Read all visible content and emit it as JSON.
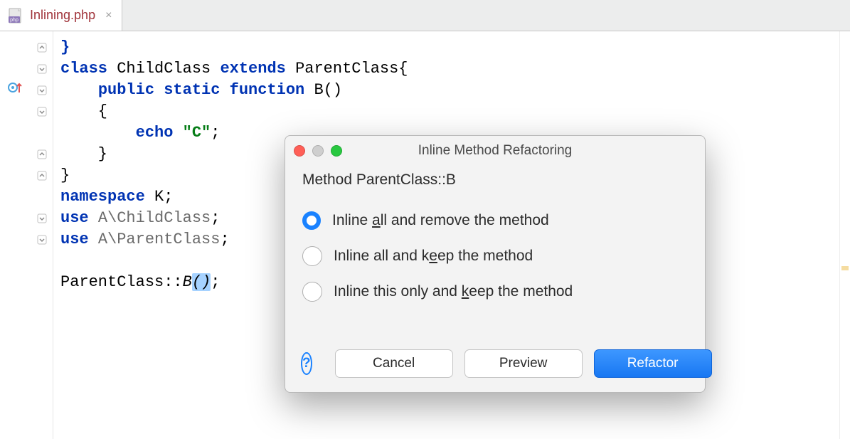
{
  "tab": {
    "filename": "Inlining.php",
    "close_glyph": "×"
  },
  "code": {
    "highlighted_line_index": 10,
    "lines": [
      {
        "tokens": [
          {
            "t": "}",
            "c": "kw"
          }
        ]
      },
      {
        "tokens": [
          {
            "t": "class ",
            "c": "kw"
          },
          {
            "t": "ChildClass ",
            "c": "cls"
          },
          {
            "t": "extends ",
            "c": "kw"
          },
          {
            "t": "ParentClass{",
            "c": "cls"
          }
        ]
      },
      {
        "tokens": [
          {
            "t": "    ",
            "c": ""
          },
          {
            "t": "public static function ",
            "c": "kw"
          },
          {
            "t": "B()",
            "c": "cls"
          }
        ]
      },
      {
        "tokens": [
          {
            "t": "    {",
            "c": "cls"
          }
        ]
      },
      {
        "tokens": [
          {
            "t": "        ",
            "c": ""
          },
          {
            "t": "echo ",
            "c": "kw"
          },
          {
            "t": "\"C\"",
            "c": "str"
          },
          {
            "t": ";",
            "c": "cls"
          }
        ]
      },
      {
        "tokens": [
          {
            "t": "    }",
            "c": "cls"
          }
        ]
      },
      {
        "tokens": [
          {
            "t": "}",
            "c": "cls"
          }
        ]
      },
      {
        "tokens": [
          {
            "t": "namespace ",
            "c": "kw"
          },
          {
            "t": "K;",
            "c": "cls"
          }
        ]
      },
      {
        "tokens": [
          {
            "t": "use ",
            "c": "kw"
          },
          {
            "t": "A\\ChildClass",
            "c": "ns"
          },
          {
            "t": ";",
            "c": "cls"
          }
        ]
      },
      {
        "tokens": [
          {
            "t": "use ",
            "c": "kw"
          },
          {
            "t": "A\\ParentClass",
            "c": "ns"
          },
          {
            "t": ";",
            "c": "cls"
          }
        ]
      },
      {
        "tokens": []
      },
      {
        "tokens": [
          {
            "t": "ParentClass::",
            "c": "cls"
          },
          {
            "t": "B",
            "c": "ital"
          },
          {
            "t": "()",
            "c": "ital caret-bg"
          },
          {
            "t": ";",
            "c": "cls"
          }
        ]
      }
    ]
  },
  "dialog": {
    "title": "Inline Method Refactoring",
    "method_label": "Method ParentClass::B",
    "options": [
      {
        "pre": "Inline ",
        "mn": "a",
        "post": "ll and remove the method",
        "selected": true
      },
      {
        "pre": "Inline all and k",
        "mn": "e",
        "post": "ep the method",
        "selected": false
      },
      {
        "pre": "Inline this only and ",
        "mn": "k",
        "post": "eep the method",
        "selected": false
      }
    ],
    "help_glyph": "?",
    "buttons": {
      "cancel": "Cancel",
      "preview": "Preview",
      "refactor": "Refactor"
    }
  }
}
